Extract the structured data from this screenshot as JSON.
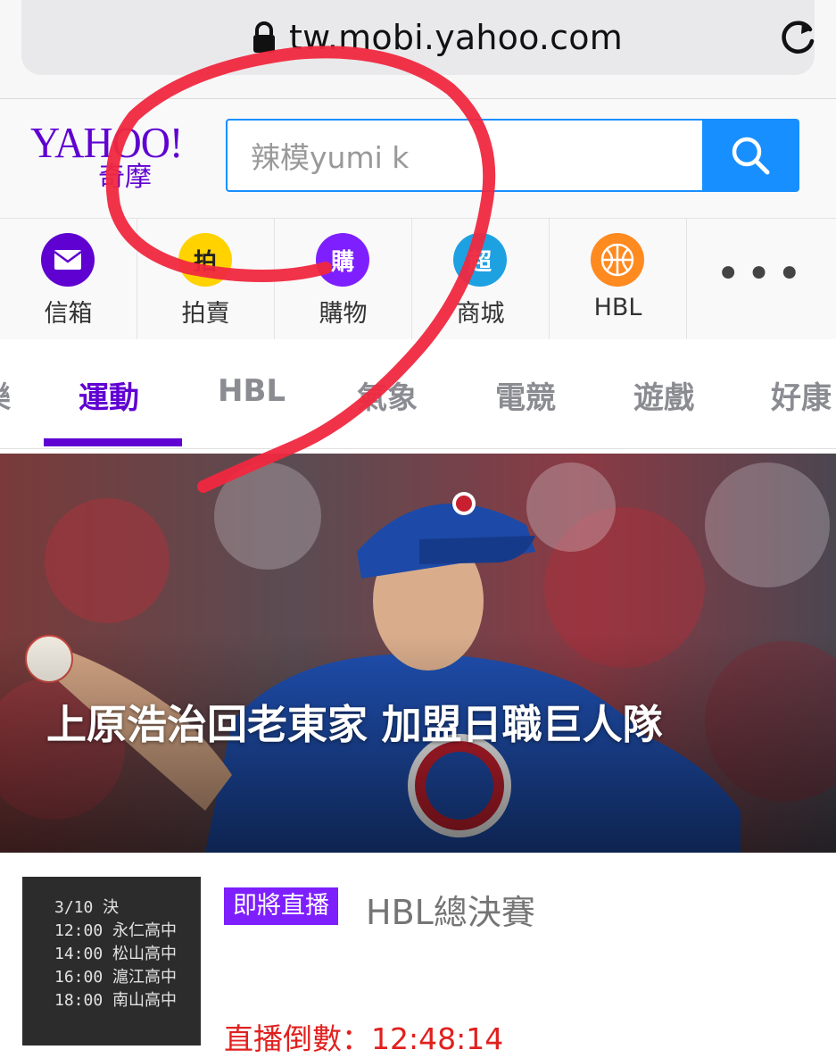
{
  "browser": {
    "url": "tw.mobi.yahoo.com"
  },
  "header": {
    "logo_main": "YAHOO!",
    "logo_sub": "奇摩",
    "search_value": "辣模yumi k"
  },
  "shortcuts": [
    {
      "label": "信箱",
      "icon": "mail-icon",
      "color": "#5f01d1"
    },
    {
      "label": "拍賣",
      "icon": "auction-icon",
      "color": "#ffd200",
      "glyph": "拍"
    },
    {
      "label": "購物",
      "icon": "shopping-icon",
      "color": "#7e1fff",
      "glyph": "購"
    },
    {
      "label": "商城",
      "icon": "mall-icon",
      "color": "#1ea1e1",
      "glyph": "超"
    },
    {
      "label": "HBL",
      "icon": "basketball-icon",
      "color": "#ff8a1f"
    },
    {
      "label": "•••",
      "icon": "more-icon"
    }
  ],
  "tabs": [
    {
      "label": "樂"
    },
    {
      "label": "運動",
      "active": true
    },
    {
      "label": "HBL"
    },
    {
      "label": "氣象"
    },
    {
      "label": "電競"
    },
    {
      "label": "遊戲"
    },
    {
      "label": "好康"
    }
  ],
  "hero": {
    "title": "上原浩治回老東家 加盟日職巨人隊"
  },
  "article": {
    "badge": "即將直播",
    "title": "HBL總決賽",
    "countdown": "直播倒數：12:48:14",
    "thumb_text": "3/10 決\n12:00 永仁高中\n14:00 松山高中\n16:00 滬江高中\n18:00 南山高中"
  },
  "colors": {
    "brand": "#5f01d1",
    "search_blue": "#188fff",
    "tab_active": "#6001d2",
    "badge": "#7e1fff",
    "countdown": "#e0211f",
    "annotation": "#f0283f"
  }
}
